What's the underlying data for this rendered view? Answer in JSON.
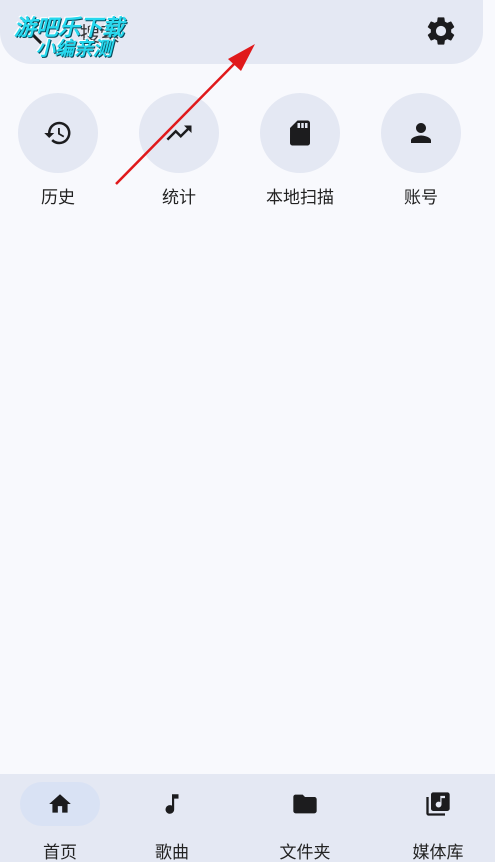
{
  "search": {
    "placeholder": "搜索"
  },
  "watermark": {
    "line1": "游吧乐下载",
    "line2": "小编亲测"
  },
  "quick_actions": [
    {
      "label": "历史",
      "icon": "history-icon"
    },
    {
      "label": "统计",
      "icon": "trending-up-icon"
    },
    {
      "label": "本地扫描",
      "icon": "sd-card-icon"
    },
    {
      "label": "账号",
      "icon": "person-icon"
    }
  ],
  "bottom_nav": [
    {
      "label": "首页",
      "icon": "home-icon",
      "active": true
    },
    {
      "label": "歌曲",
      "icon": "music-note-icon",
      "active": false
    },
    {
      "label": "文件夹",
      "icon": "folder-icon",
      "active": false
    },
    {
      "label": "媒体库",
      "icon": "library-music-icon",
      "active": false
    }
  ],
  "colors": {
    "background": "#f8f9fd",
    "surface": "#e4e8f3",
    "annotation_arrow": "#e0191b",
    "watermark": "#27d8ee"
  }
}
